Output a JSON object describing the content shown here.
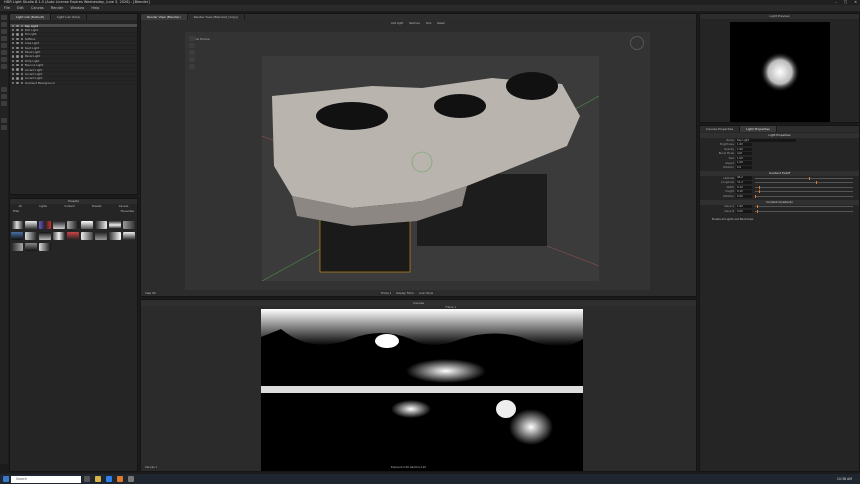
{
  "app": {
    "title": "HDR Light Studio 8.1.0 (Auto License Expires Wednesday, June 3, 2026) - [Blender]",
    "menus": [
      "File",
      "Edit",
      "Canvas",
      "Render",
      "Window",
      "Help"
    ]
  },
  "left_panel": {
    "tabs": [
      "Light List (Default)",
      "Light List (Solo)"
    ],
    "lights": [
      {
        "name": "Key Light",
        "selected": true
      },
      {
        "name": "Rim Light",
        "selected": false
      },
      {
        "name": "Fill Light",
        "selected": false
      },
      {
        "name": "Softbox",
        "selected": false
      },
      {
        "name": "Area Light",
        "selected": false
      },
      {
        "name": "Spot Light",
        "selected": false
      },
      {
        "name": "Panel Light",
        "selected": false
      },
      {
        "name": "Panel Light",
        "selected": false
      },
      {
        "name": "Strip Light",
        "selected": false
      },
      {
        "name": "Bounce Light",
        "selected": false
      },
      {
        "name": "Accent Light",
        "selected": false
      },
      {
        "name": "Accent Light",
        "selected": false
      },
      {
        "name": "Accent Light",
        "selected": false
      },
      {
        "name": "Gradient Background",
        "selected": false
      }
    ]
  },
  "presets_panel": {
    "title": "Presets",
    "tabs": [
      "All",
      "Lights",
      "Content",
      "Presets",
      "Canvas"
    ],
    "filter_label": "Filter",
    "favourites_label": "Favourites"
  },
  "viewport": {
    "tabs": [
      "Render View (Blender)",
      "Render View (Blender) (Copy)"
    ],
    "toolbar_items": [
      "Add Light",
      "Remove",
      "Solo",
      "Reset"
    ],
    "overlay_text": "Material Preview",
    "footer_items": [
      "Frame 1",
      "Display: Filmic",
      "Look: None"
    ],
    "view_tab": "View 3D"
  },
  "canvas": {
    "title": "Canvas",
    "zoom": "Frame 1",
    "footer_left": "Canvas 1",
    "footer_mid": "Exposure 0.00   Gamma 2.20",
    "status_right": "Light Preview: HDR"
  },
  "light_preview": {
    "title": "Light Preview"
  },
  "properties": {
    "tabs": [
      "Canvas Properties",
      "Light Properties"
    ],
    "header": "Light Properties",
    "fields": [
      {
        "key": "Name",
        "value": "Key Light"
      },
      {
        "key": "Brightness",
        "value": "1.00"
      },
      {
        "key": "Opacity",
        "value": "1.00"
      },
      {
        "key": "Blend Mode",
        "value": "Add"
      },
      {
        "key": "Size",
        "value": "1.00"
      },
      {
        "key": "Aspect",
        "value": "1.00"
      },
      {
        "key": "Rotation",
        "value": "0.0"
      }
    ],
    "section_gradient": "Gradient Falloff",
    "gradient_fields": [
      {
        "key": "Latitude",
        "value": "40.2",
        "level": 0.55
      },
      {
        "key": "Longitude",
        "value": "31.4",
        "level": 0.62
      },
      {
        "key": "Width",
        "value": "0.10",
        "level": 0.04
      },
      {
        "key": "Height",
        "value": "0.10",
        "level": 0.04
      },
      {
        "key": "Rotation",
        "value": "0.00",
        "level": 0.0
      }
    ],
    "section_content": "Content (Gradient)",
    "content_fields": [
      {
        "key": "Value A",
        "value": "1.00",
        "level": 0.02
      },
      {
        "key": "Value B",
        "value": "0.00",
        "level": 0.02
      }
    ],
    "footer": "Enable all Lights and Backdrops"
  },
  "taskbar": {
    "search_placeholder": "Search",
    "time": "10:38 AM"
  },
  "colors": {
    "accent": "#e07a2a",
    "panel": "#252525",
    "selection": "#4b4b4b"
  }
}
